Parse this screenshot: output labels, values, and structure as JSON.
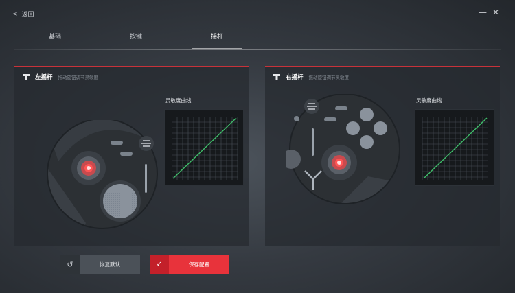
{
  "header": {
    "back_label": "返回",
    "minimize_glyph": "—",
    "close_glyph": "✕"
  },
  "tabs": [
    {
      "label": "基础",
      "active": false
    },
    {
      "label": "按键",
      "active": false
    },
    {
      "label": "摇杆",
      "active": true
    }
  ],
  "panels": {
    "left": {
      "title": "左摇杆",
      "subtitle": "拖动旋钮调节灵敏度",
      "curve_label": "灵敏度曲线",
      "icon": "joystick-icon"
    },
    "right": {
      "title": "右摇杆",
      "subtitle": "拖动旋钮调节灵敏度",
      "curve_label": "灵敏度曲线",
      "icon": "joystick-icon"
    }
  },
  "actions": {
    "reset_label": "恢复默认",
    "reset_icon": "undo-icon",
    "save_label": "保存配置",
    "save_icon": "check-icon"
  },
  "colors": {
    "accent": "#e8333b",
    "curve_line": "#3fbf6a",
    "joystick_dot": "#e63a3a"
  }
}
